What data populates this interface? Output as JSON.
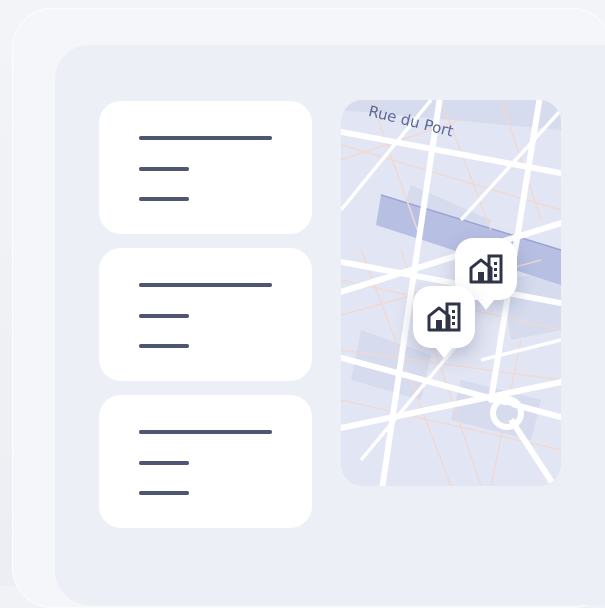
{
  "map": {
    "street_label": "Rue du Port",
    "colors": {
      "background": "#e2e5f3",
      "roads": "#ffffff",
      "blocks": "#d6dbee",
      "rail": "#b7bfe3",
      "minor_streets": "#f0d9d2"
    },
    "pins": [
      {
        "icon": "buildings-icon"
      },
      {
        "icon": "buildings-icon"
      }
    ]
  },
  "list": {
    "cards": [
      {
        "icon": "text-lines-icon"
      },
      {
        "icon": "text-lines-icon"
      },
      {
        "icon": "text-lines-icon"
      }
    ]
  },
  "colors": {
    "background": "#f1f2f6",
    "panel": "#eceff6",
    "card": "#ffffff",
    "line": "#4f5671"
  }
}
